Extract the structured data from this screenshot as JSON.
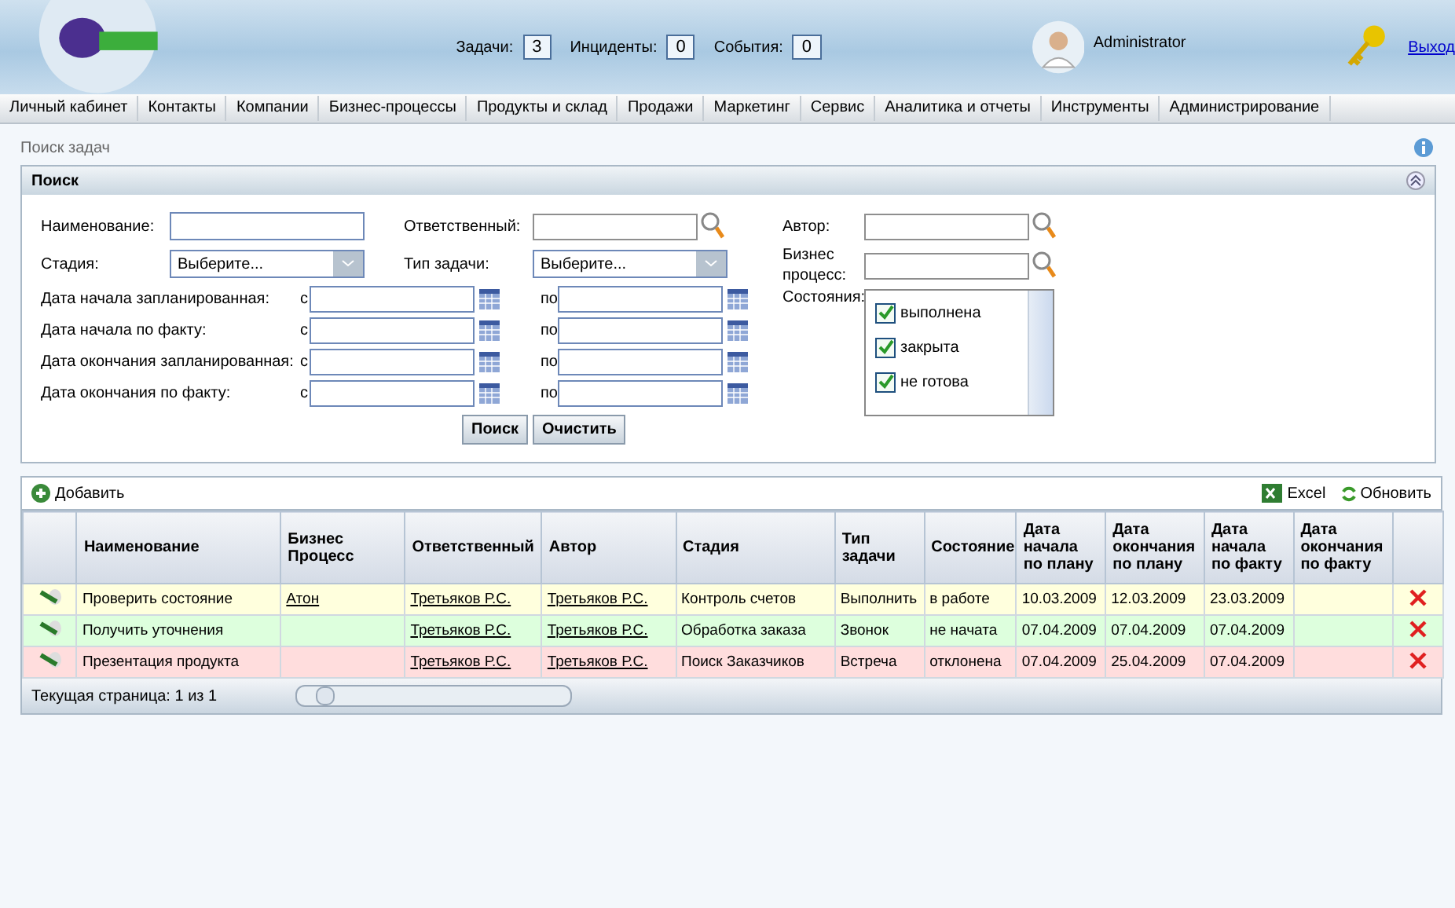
{
  "header": {
    "counters": [
      {
        "label": "Задачи:",
        "value": "3"
      },
      {
        "label": "Инциденты:",
        "value": "0"
      },
      {
        "label": "События:",
        "value": "0"
      }
    ],
    "user": "Administrator",
    "logout": "Выход"
  },
  "menu": [
    {
      "label": "Личный кабинет"
    },
    {
      "label": "Контакты"
    },
    {
      "label": "Компании"
    },
    {
      "label": "Бизнес-процессы"
    },
    {
      "label": "Продукты и склад"
    },
    {
      "label": "Продажи"
    },
    {
      "label": "Маркетинг"
    },
    {
      "label": "Сервис"
    },
    {
      "label": "Аналитика и отчеты"
    },
    {
      "label": "Инструменты"
    },
    {
      "label": "Администрирование"
    }
  ],
  "page_title": "Поиск задач",
  "search": {
    "title": "Поиск",
    "name_label": "Наименование:",
    "responsible_label": "Ответственный:",
    "author_label": "Автор:",
    "stage_label": "Стадия:",
    "stage_value": "Выберите...",
    "type_label": "Тип задачи:",
    "type_value": "Выберите...",
    "bp_label": "Бизнес процесс:",
    "date_rows": [
      {
        "label": "Дата начала запланированная:",
        "from": "с",
        "to": "по"
      },
      {
        "label": "Дата начала по факту:",
        "from": "с",
        "to": "по"
      },
      {
        "label": "Дата окончания запланированная:",
        "from": "с",
        "to": "по"
      },
      {
        "label": "Дата окончания по факту:",
        "from": "с",
        "to": "по"
      }
    ],
    "states_label": "Состояния:",
    "states": [
      {
        "label": "выполнена",
        "checked": true
      },
      {
        "label": "закрыта",
        "checked": true
      },
      {
        "label": "не готова",
        "checked": true
      }
    ],
    "buttons": [
      "Поиск",
      "Очистить"
    ]
  },
  "toolbar": {
    "add": "Добавить",
    "excel": "Excel",
    "refresh": "Обновить"
  },
  "table": {
    "columns": [
      "Наименование",
      "Бизнес Процесс",
      "Ответственный",
      "Автор",
      "Стадия",
      "Тип задачи",
      "Состояние",
      "Дата начала по плану",
      "Дата окончания по плану",
      "Дата начала по факту",
      "Дата окончания по факту"
    ],
    "rows": [
      {
        "color": "#ffffdd",
        "cells": [
          "Проверить состояние",
          "Атон",
          "Третьяков Р.С.",
          "Третьяков Р.С.",
          "Контроль счетов",
          "Выполнить",
          "в работе",
          "10.03.2009",
          "12.03.2009",
          "23.03.2009",
          ""
        ]
      },
      {
        "color": "#ddffdd",
        "cells": [
          "Получить уточнения",
          "",
          "Третьяков Р.С.",
          "Третьяков Р.С.",
          "Обработка заказа",
          "Звонок",
          "не начата",
          "07.04.2009",
          "07.04.2009",
          "07.04.2009",
          ""
        ]
      },
      {
        "color": "#ffdddd",
        "cells": [
          "Презентация продукта",
          "",
          "Третьяков Р.С.",
          "Третьяков Р.С.",
          "Поиск Заказчиков",
          "Встреча",
          "отклонена",
          "07.04.2009",
          "25.04.2009",
          "07.04.2009",
          ""
        ]
      }
    ]
  },
  "pager": "Текущая страница: 1 из 1"
}
